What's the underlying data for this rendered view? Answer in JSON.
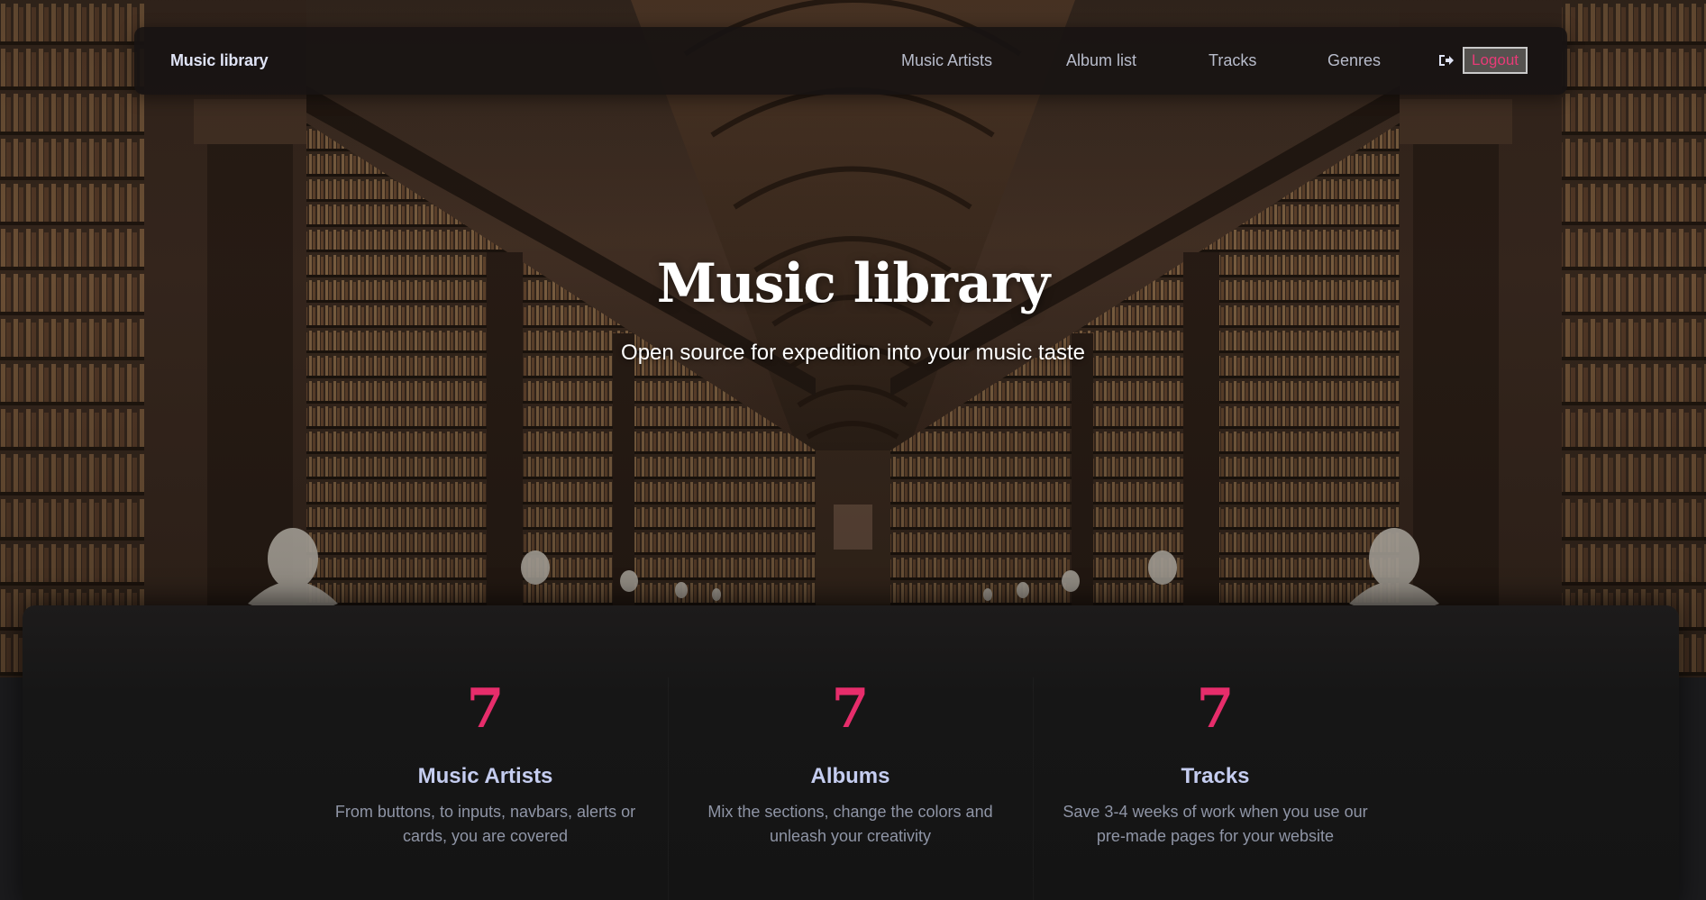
{
  "navbar": {
    "brand": "Music library",
    "links": [
      {
        "label": "Music Artists"
      },
      {
        "label": "Album list"
      },
      {
        "label": "Tracks"
      },
      {
        "label": "Genres"
      }
    ],
    "logout": {
      "icon": "sign-out-icon",
      "label": "Logout"
    }
  },
  "hero": {
    "title": "Music library",
    "subtitle": "Open source for expedition into your music taste"
  },
  "stats": [
    {
      "number": "7",
      "title": "Music Artists",
      "description": "From buttons, to inputs, navbars, alerts or cards, you are covered"
    },
    {
      "number": "7",
      "title": "Albums",
      "description": "Mix the sections, change the colors and unleash your creativity"
    },
    {
      "number": "7",
      "title": "Tracks",
      "description": "Save 3-4 weeks of work when you use our pre-made pages for your website"
    }
  ],
  "colors": {
    "accent": "#e62d6b",
    "title": "#c5cdf0",
    "nav_text": "#b8bccb",
    "panel_bg": "#141414"
  }
}
